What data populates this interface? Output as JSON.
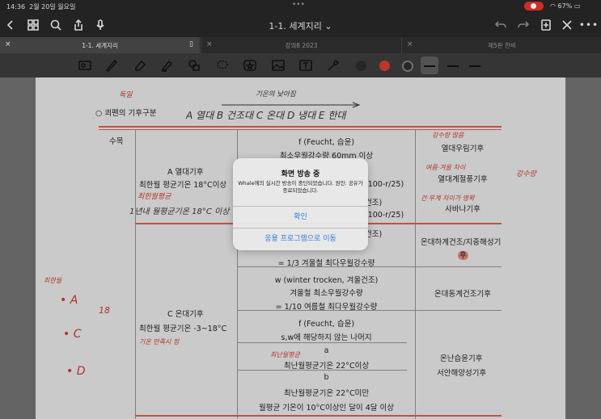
{
  "status_bar": {
    "time": "14:36",
    "date": "2월 20일 월요일",
    "battery": "67%"
  },
  "nav": {
    "title": "1-1. 세계지리 ⌄"
  },
  "tabs": [
    {
      "label": "1-1. 세계지리",
      "active": true
    },
    {
      "label": "강의8 2023",
      "active": false
    },
    {
      "label": "제5판 한비",
      "active": false
    }
  ],
  "toolbar": {
    "colors": [
      "#2a2a2a",
      "#d23a2a",
      "#2a2a2a"
    ]
  },
  "note": {
    "heading": "○ 쾨펜의 기후구분",
    "handwriting": {
      "top_label": "독일",
      "arrow_label": "기온의 낮아짐",
      "climate_list": "A 열대  B 건조대  C 온대  D 냉대  E 한대",
      "suffix_mok": "수목",
      "a_note1": "최한월평균",
      "a_note2": "1년내 월평균기온 18°C 이상",
      "rain_a1": "강수량 많음",
      "rain_a2": "여름·겨울 차이",
      "rain_a3": "건·우계 차이가 명확",
      "rain_side": "강수량",
      "left_title": "최한월",
      "left_a": "• A",
      "left_c": "• C",
      "left_d": "• D",
      "left_18": "18",
      "c_note": "기온 만족시 점",
      "cfa_note": "최난월평균"
    },
    "climate_a": {
      "title": "A 열대기후",
      "rule": "최한월 평균기온 18°C이상"
    },
    "climate_c": {
      "title": "C 온대기후",
      "rule": "최한월 평균기온 -3~18°C"
    },
    "rows": {
      "f_title": "f (Feucht, 습윤)",
      "f_rule": "최소우월강수량 60mm 이상",
      "m_rule": "(100-r/25)",
      "w_title": "건조)",
      "w_rule": "(100-r/25)",
      "s_rule": "건조)",
      "s_ratio": "= 1/3 겨울철 최다우월강수량",
      "cw_title": "w (winter trocken, 겨울건조)",
      "cw_rule": "겨울철 최소우월강수량",
      "cw_ratio": "= 1/10 여름철 최다우월강수량",
      "cf_title": "f (Feucht, 습윤)",
      "cf_rule": "s,w에 해당하지 않는 나머지",
      "a_label": "a",
      "a_rule": "최난월평균기온 22°C이상",
      "b_label": "b",
      "b_rule": "최난월평균기온 22°C미만",
      "b_rule2": "월평균 기온이 10°C이상인 달이 4달 이상"
    },
    "results": {
      "af": "열대우림기후",
      "am": "열대계절풍기후",
      "aw": "사바나기후",
      "cs": "온대하계건조/지중해성기",
      "cs_tail": "후",
      "cw": "온대동계건조기후",
      "cfa": "온난습윤기후",
      "cfb": "서안해양성기후"
    }
  },
  "alert": {
    "title": "화면 방송 중",
    "message": "Whale에의 실시간 방송이 중단되었습니다. 원인: 공유가 종료되었습니다.",
    "confirm": "확인",
    "goto_app": "응용 프로그램으로 이동"
  }
}
